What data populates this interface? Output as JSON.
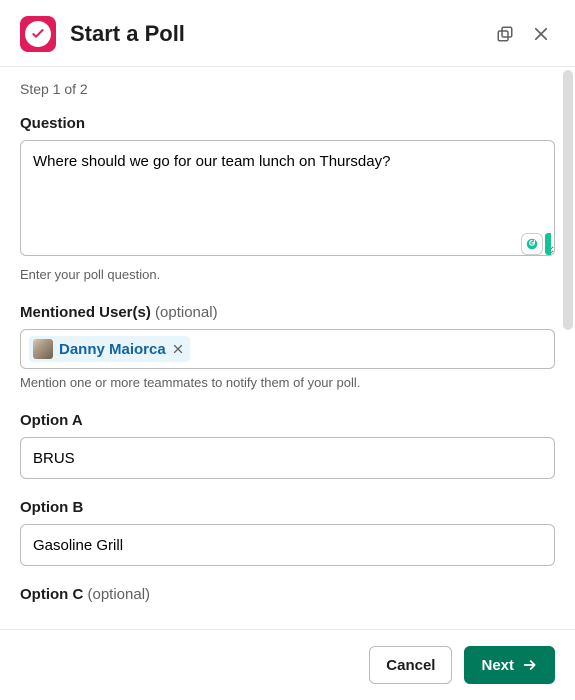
{
  "header": {
    "title": "Start a Poll"
  },
  "step_text": "Step 1 of 2",
  "question": {
    "label": "Question",
    "value": "Where should we go for our team lunch on Thursday?",
    "help": "Enter your poll question."
  },
  "mentions": {
    "label": "Mentioned User(s)",
    "optional": "(optional)",
    "chip_name": "Danny Maiorca",
    "help": "Mention one or more teammates to notify them of your poll."
  },
  "options": {
    "a": {
      "label": "Option A",
      "value": "BRUS"
    },
    "b": {
      "label": "Option B",
      "value": "Gasoline Grill"
    },
    "c": {
      "label": "Option C",
      "optional": "(optional)",
      "value": ""
    }
  },
  "footer": {
    "cancel": "Cancel",
    "next": "Next"
  }
}
